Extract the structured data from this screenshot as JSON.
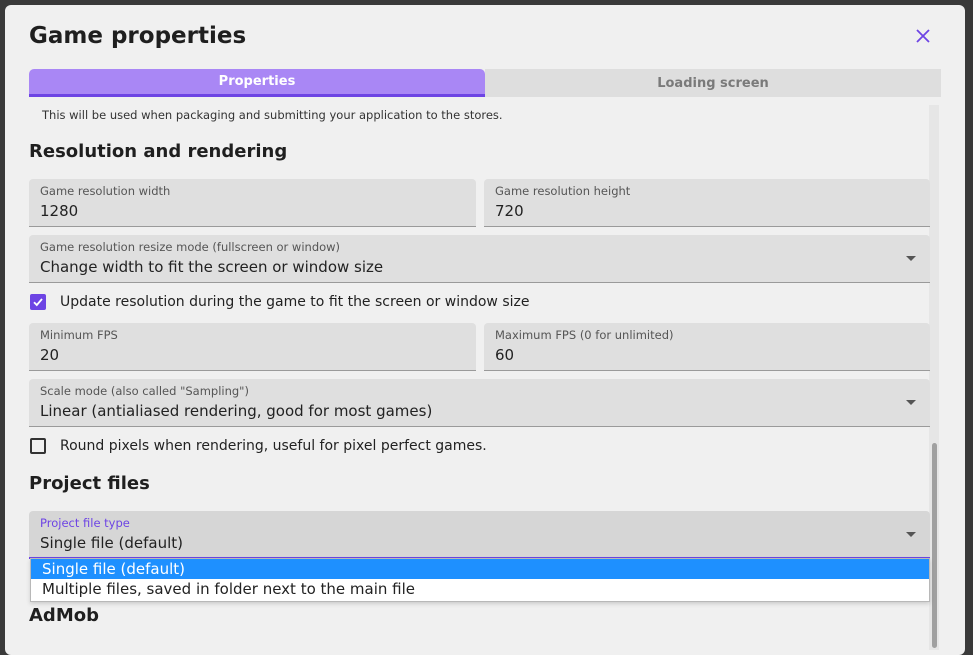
{
  "dialog": {
    "title": "Game properties"
  },
  "tabs": [
    {
      "label": "Properties",
      "active": true
    },
    {
      "label": "Loading screen",
      "active": false
    }
  ],
  "helper_text": "This will be used when packaging and submitting your application to the stores.",
  "resolution_section": {
    "title": "Resolution and rendering",
    "width": {
      "label": "Game resolution width",
      "value": "1280"
    },
    "height": {
      "label": "Game resolution height",
      "value": "720"
    },
    "resize_mode": {
      "label": "Game resolution resize mode (fullscreen or window)",
      "value": "Change width to fit the screen or window size"
    },
    "update_resolution": {
      "label": "Update resolution during the game to fit the screen or window size",
      "checked": true
    },
    "min_fps": {
      "label": "Minimum FPS",
      "value": "20"
    },
    "max_fps": {
      "label": "Maximum FPS (0 for unlimited)",
      "value": "60"
    },
    "scale_mode": {
      "label": "Scale mode (also called \"Sampling\")",
      "value": "Linear (antialiased rendering, good for most games)"
    },
    "round_pixels": {
      "label": "Round pixels when rendering, useful for pixel perfect games.",
      "checked": false
    }
  },
  "project_files_section": {
    "title": "Project files",
    "file_type": {
      "label": "Project file type",
      "value": "Single file (default)"
    },
    "options": [
      {
        "label": "Single file (default)",
        "selected": true
      },
      {
        "label": "Multiple files, saved in folder next to the main file",
        "selected": false
      }
    ]
  },
  "admob_section": {
    "title": "AdMob"
  },
  "icons": {
    "close": "close-icon",
    "check": "check-icon",
    "dropdown": "chevron-down-icon"
  },
  "colors": {
    "accent": "#6d44e4",
    "tab_active": "#a987f5",
    "menu_highlight": "#1e90ff"
  }
}
